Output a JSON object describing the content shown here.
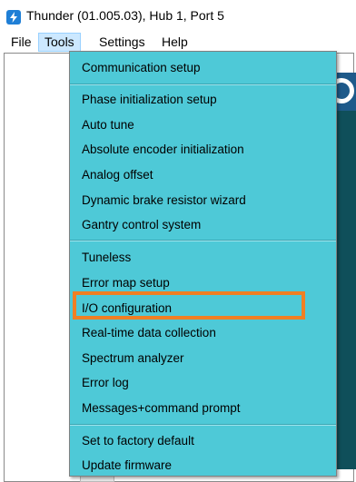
{
  "window": {
    "title": "Thunder (01.005.03), Hub 1, Port 5",
    "icon": "thunder-app-icon"
  },
  "menubar": {
    "items": [
      {
        "label": "File"
      },
      {
        "label": "Tools"
      },
      {
        "label": "Settings"
      },
      {
        "label": "Help"
      }
    ],
    "active": "Tools"
  },
  "tools_menu": {
    "groups": [
      [
        "Communication setup"
      ],
      [
        "Phase initialization setup",
        "Auto tune",
        "Absolute encoder initialization",
        "Analog offset",
        "Dynamic brake resistor wizard",
        "Gantry control system"
      ],
      [
        "Tuneless",
        "Error map setup",
        "I/O configuration",
        "Real-time data collection",
        "Spectrum analyzer",
        "Error log",
        "Messages+command prompt"
      ],
      [
        "Set to factory default",
        "Update firmware"
      ]
    ],
    "highlighted_item": "I/O configuration",
    "highlight_color": "#f07f23",
    "menu_color": "#4ec9d7"
  }
}
